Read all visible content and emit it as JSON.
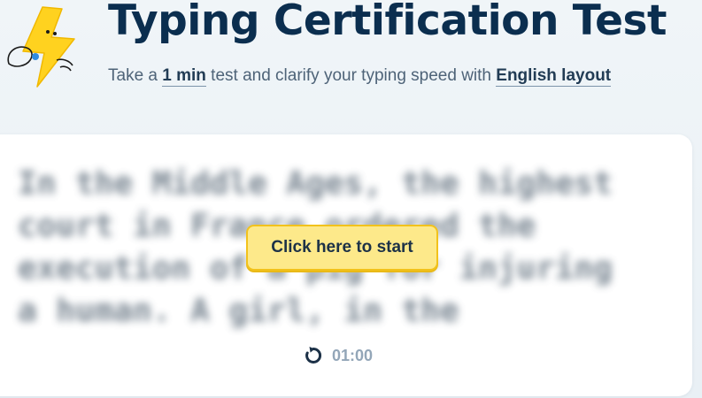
{
  "header": {
    "title": "Typing Certification Test",
    "subtitle_prefix": "Take a ",
    "duration_link": "1 min",
    "subtitle_middle": " test and clarify your typing speed with ",
    "layout_link": "English layout",
    "mascot_icon": "lightning-mascot-icon"
  },
  "typing_area": {
    "blurred_text": "In the Middle Ages, the highest court in France ordered the execution of a pig for injuring a human. A girl, in the",
    "start_label": "Click here to start",
    "timer_icon": "restart-icon",
    "timer_value": "01:00"
  },
  "colors": {
    "title": "#0b2e4f",
    "accent_yellow": "#fde98a",
    "button_border": "#f2c21b",
    "timer": "#93a6b8"
  }
}
